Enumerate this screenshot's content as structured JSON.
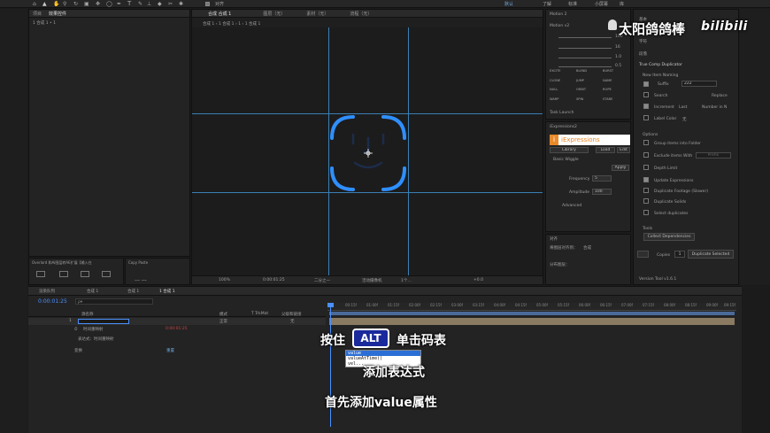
{
  "toolbar": {
    "align_label": "对齐",
    "workspace_label": "默认",
    "learn_label": "了解",
    "standard_label": "标准",
    "small_screen_label": "小屏幕",
    "library_label": "库"
  },
  "watermark": {
    "channel_name": "太阳鸽鸽棒",
    "platform_logo": "bilibili"
  },
  "project_panel": {
    "tab_project": "项目",
    "tab_effects": "效果控件",
    "comp_path": "1 合成 1 • 1"
  },
  "viewer": {
    "tab_comp": "合成 合成 1",
    "tab_layer": "图层（无）",
    "tab_footage": "素材（无）",
    "tab_flow": "流程（无）",
    "breadcrumb": "合成 1 ‹ 1 合成 1 › 1 ‹ 1 合成 1",
    "zoom": "100%",
    "timecode": "0:00:01:25",
    "resolution": "二分之一",
    "camera": "活动摄像机",
    "views": "1个…",
    "offset": "+0.0"
  },
  "overlord_panel": {
    "title": "Overlord 和Ai图层转AE扩展【输入在",
    "copy_paste_title": "Copy Paste",
    "copy_paste_text": "… …"
  },
  "motion2": {
    "title": "Motion 2",
    "version_label": "Motion v2",
    "values": [
      "100",
      "16",
      "1.0",
      "0.5"
    ],
    "buttons": [
      "EXCITE",
      "BLEND",
      "BURST",
      "CLONE",
      "JUMP",
      "NAME",
      "NULL",
      "ORBIT",
      "ROPE",
      "WARP",
      "SPIN",
      "STARE"
    ],
    "task_launch": "Task Launch"
  },
  "iexpressions": {
    "panel_title": "iExpressions2",
    "header": "iExpressions",
    "tabs": [
      "Library",
      "Load",
      "Edit"
    ],
    "section": "Basic Wiggle",
    "apply": "Apply",
    "params": [
      {
        "label": "Frequency",
        "value": "5"
      },
      {
        "label": "Amplitude",
        "value": "100"
      }
    ],
    "advanced": "Advanced"
  },
  "right_header": {
    "item1": "基本",
    "item2": "字符",
    "item3": "段落"
  },
  "true_comp_duplicator": {
    "title": "True Comp Duplicator",
    "naming_section": "New Item Naming",
    "suffix_label": "Suffix",
    "suffix_value": "222",
    "search_label": "Search",
    "replace_label": "Replace",
    "increment_label": "Increment",
    "increment_mode": "Last",
    "number_label": "Number in N",
    "label_color": "Label Color",
    "label_color_value": "无",
    "options_section": "Options",
    "options": [
      {
        "label": "Group items into Folder",
        "checked": false
      },
      {
        "label": "Exclude items With",
        "checked": false
      },
      {
        "label": "Depth Limit",
        "checked": false
      },
      {
        "label": "Update Expressions",
        "checked": true
      },
      {
        "label": "Duplicate Footage (Slower)",
        "checked": false
      },
      {
        "label": "Duplicate Solids",
        "checked": false
      },
      {
        "label": "Select duplicates",
        "checked": false
      }
    ],
    "exclude_placeholder": "Prefix",
    "tools_section": "Tools",
    "collect_button": "Collect Dependencies",
    "copies_label": "Copies",
    "copies_value": "1",
    "duplicate_button": "Duplicate Selected",
    "version": "Version Tool v1.6.1"
  },
  "align_panel": {
    "title": "对齐",
    "align_to": "将图层对齐到：",
    "align_to_value": "合成",
    "distribute": "分布图层："
  },
  "timeline": {
    "tabs": [
      "渲染队列",
      "合成 1",
      "合成 1",
      "1 合成 1"
    ],
    "timecode": "0:00:01:25",
    "search_placeholder": "ρ▾",
    "columns": [
      "源名称",
      "模式",
      "T TrkMat",
      "父级和链接"
    ],
    "layer": {
      "index": "1",
      "name": "",
      "mode": "正常",
      "parent": "无"
    },
    "sub_row": "时间重映射",
    "sub_row_value": "0:00:01:25",
    "expression_label": "表达式：时间重映射",
    "transform_label": "变换",
    "reset_label": "重置",
    "ticks": [
      "00:15f",
      "01:00f",
      "01:15f",
      "02:00f",
      "02:15f",
      "03:00f",
      "03:15f",
      "04:00f",
      "04:15f",
      "05:00f",
      "05:15f",
      "06:00f",
      "06:15f",
      "07:00f",
      "07:15f",
      "08:00f",
      "08:15f",
      "09:00f",
      "09:15f",
      "10:00f"
    ]
  },
  "autocomplete": {
    "items": [
      "value",
      "valueAtTime()",
      "vel..."
    ]
  },
  "subtitles": {
    "line1_pre": "按住",
    "key": "ALT",
    "line1_post": "单击码表",
    "line2": "添加表达式",
    "line3": "首先添加value属性"
  },
  "colors": {
    "accent_blue": "#2f8fff",
    "guide": "#3a7fb2",
    "iexp_orange": "#e8892a",
    "key_bg": "#1a2a9c"
  }
}
